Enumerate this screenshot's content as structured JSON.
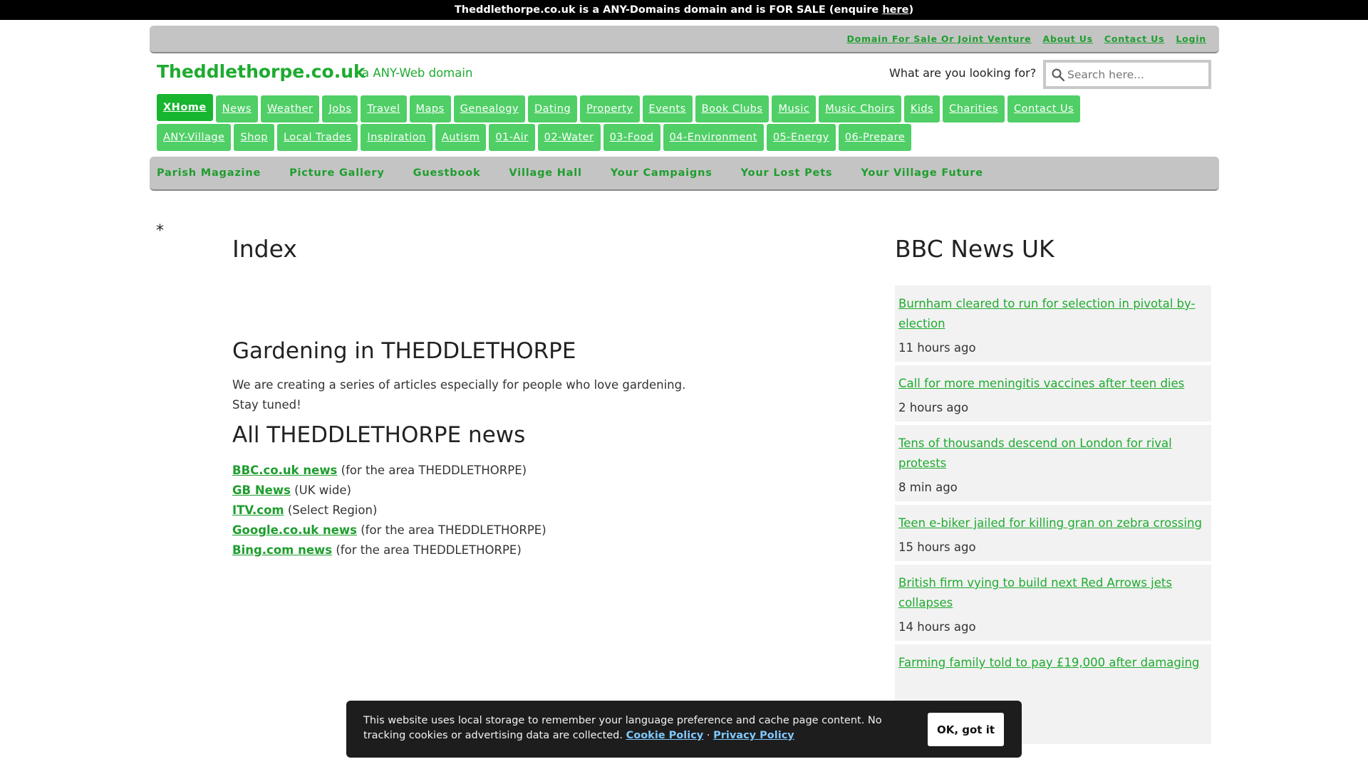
{
  "sale_bar": {
    "text": "Theddlethorpe.co.uk is a ANY-Domains domain and is FOR SALE (enquire ",
    "link": "here",
    "close": ")"
  },
  "util_links": [
    "Domain For Sale Or Joint Venture",
    "About Us",
    "Contact Us",
    "Login"
  ],
  "brand": {
    "title": "Theddlethorpe.co.uk",
    "tagline": "a ANY-Web domain"
  },
  "search": {
    "label": "What are you looking for?",
    "placeholder": "Search here..."
  },
  "nav_row1": [
    {
      "label": "XHome",
      "active": true
    },
    {
      "label": "News",
      "u": true
    },
    {
      "label": "Weather"
    },
    {
      "label": "Jobs"
    },
    {
      "label": "Travel",
      "u": true
    },
    {
      "label": "Maps"
    },
    {
      "label": "Genealogy"
    },
    {
      "label": "Dating"
    },
    {
      "label": "Property"
    },
    {
      "label": "Events"
    },
    {
      "label": "Book Clubs"
    },
    {
      "label": "Music",
      "u": true
    },
    {
      "label": "Music Choirs"
    },
    {
      "label": "Kids"
    },
    {
      "label": "Charities"
    },
    {
      "label": "Contact Us"
    }
  ],
  "nav_row2": [
    {
      "label": "ANY-Village"
    },
    {
      "label": "Shop",
      "u": true
    },
    {
      "label": "Local Trades",
      "u": true
    },
    {
      "label": "Inspiration"
    },
    {
      "label": "Autism"
    },
    {
      "label": "01-Air"
    },
    {
      "label": "02-Water"
    },
    {
      "label": "03-Food"
    },
    {
      "label": "04-Environment",
      "u": true
    },
    {
      "label": "05-Energy",
      "u": true
    },
    {
      "label": "06-Prepare"
    }
  ],
  "sub_nav": [
    "Parish Magazine",
    "Picture Gallery",
    "Guestbook",
    "Village Hall",
    "Your Campaigns",
    "Your Lost Pets",
    "Your Village Future"
  ],
  "main": {
    "asterisk": "*",
    "index_title": "Index",
    "gardening_title": "Gardening in THEDDLETHORPE",
    "gardening_text_1": "We are creating a series of articles especially for people who love gardening.",
    "gardening_text_2": "Stay tuned!",
    "all_news_title": "All THEDDLETHORPE news",
    "news_links": [
      {
        "link": "BBC.co.uk news",
        "note": " (for the area THEDDLETHORPE)"
      },
      {
        "link": "GB News",
        "note": " (UK wide)"
      },
      {
        "link": "ITV.com",
        "note": " (Select Region)"
      },
      {
        "link": "Google.co.uk news",
        "note": " (for the area THEDDLETHORPE)"
      },
      {
        "link": "Bing.com news",
        "note": " (for the area THEDDLETHORPE)"
      }
    ]
  },
  "sidebar": {
    "title": "BBC News UK",
    "items": [
      {
        "headline": "Burnham cleared to run for selection in pivotal by-election",
        "ago": "11 hours ago"
      },
      {
        "headline": "Call for more meningitis vaccines after teen dies",
        "ago": "2 hours ago"
      },
      {
        "headline": "Tens of thousands descend on London for rival protests",
        "ago": "8 min ago"
      },
      {
        "headline": "Teen e-biker jailed for killing gran on zebra crossing",
        "ago": "15 hours ago"
      },
      {
        "headline": "British firm vying to build next Red Arrows jets collapses",
        "ago": "14 hours ago"
      },
      {
        "headline": "Farming family told to pay £19,000 after damaging",
        "ago": ""
      }
    ]
  },
  "cookie": {
    "text": "This website uses local storage to remember your language preference and cache page content. No tracking cookies or advertising data are collected. ",
    "cookie_policy": "Cookie Policy",
    "sep": " · ",
    "privacy_policy": "Privacy Policy",
    "ok": "OK, got it"
  },
  "icons": {
    "search": "search-icon"
  }
}
